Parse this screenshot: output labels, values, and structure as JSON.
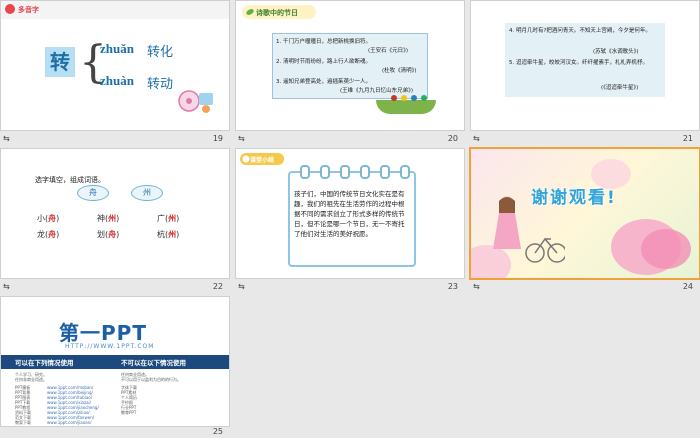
{
  "slides": [
    {
      "number": "19",
      "tag": "多音字",
      "char": "转",
      "readings": [
        {
          "pinyin": "zhuǎn",
          "word": "转化"
        },
        {
          "pinyin": "zhuàn",
          "word": "转动"
        }
      ]
    },
    {
      "number": "20",
      "header": "诗歌中的节日",
      "poems": [
        {
          "line": "1. 千门万户曈曈日，总把新桃换旧符。",
          "source": "(王安石《元日》)"
        },
        {
          "line": "2. 清明时节雨纷纷，路上行人欲断魂。",
          "source": "(杜牧《清明》)"
        },
        {
          "line": "3. 遥知兄弟登高处，遍插茱萸少一人。",
          "source": "(王维《九月九日忆山东兄弟》)"
        }
      ]
    },
    {
      "number": "21",
      "poems": [
        {
          "line": "4. 明月几时有?把酒问青天。不知天上宫阙，今夕是何年。",
          "source": "(苏轼《水调歌头》)"
        },
        {
          "line": "5. 迢迢牵牛星，皎皎河汉女。纤纤擢素手，札札弄机杼。",
          "source": "(《迢迢牵牛星》)"
        }
      ]
    },
    {
      "number": "22",
      "question": "选字填空，组成词语。",
      "options": [
        "舟",
        "州"
      ],
      "rows": [
        [
          {
            "pre": "小(",
            "ans": "舟",
            "post": ")"
          },
          {
            "pre": "神(",
            "ans": "州",
            "post": ")"
          },
          {
            "pre": "广(",
            "ans": "州",
            "post": ")"
          }
        ],
        [
          {
            "pre": "龙(",
            "ans": "舟",
            "post": ")"
          },
          {
            "pre": "划(",
            "ans": "舟",
            "post": ")"
          },
          {
            "pre": "杭(",
            "ans": "州",
            "post": ")"
          }
        ]
      ]
    },
    {
      "number": "23",
      "header": "课堂小结",
      "text": "孩子们，中国的传统节日文化实在是有趣，我们的祖先在生活劳作的过程中根据不同的需求创立了形式多样的传统节日，但不论是哪一个节日，无一不寄托了他们对生活的美好祝愿。"
    },
    {
      "number": "24",
      "title": "谢谢观看!"
    },
    {
      "number": "25",
      "logo": "第一PPT",
      "url": "HTTP://WWW.1PPT.COM",
      "left_head": "可以在下列情况使用",
      "right_head": "不可以在以下情况使用",
      "left_items": [
        "个人学习、研究。",
        "任何非商业用途。",
        "PPT模板",
        "PPT背景",
        "PPT图表",
        "PPT下载",
        "PPT教程",
        "资料下载",
        "范文下载",
        "教案下载"
      ],
      "right_items": [
        "任何商业用途。",
        "不可以用于以盈利为目的的行为。",
        "字体下载",
        "PPT素材",
        "个人简历",
        "手抄报",
        "行业PPT",
        "教育PPT"
      ],
      "links": [
        "www.1ppt.com/moban/",
        "www.1ppt.com/beijing/",
        "www.1ppt.com/tubiao/",
        "www.1ppt.com/xiazai/",
        "www.1ppt.com/jiaocheng/",
        "www.1ppt.com/ziliao/",
        "www.1ppt.com/fanwen/",
        "www.1ppt.com/jiaoan/"
      ]
    }
  ],
  "colors": {
    "selected_border": "#f0a23a",
    "accent_blue": "#1d6fa8",
    "answer_red": "#d62828"
  },
  "icons": {
    "slide_footer": "slide-transition-icon"
  }
}
